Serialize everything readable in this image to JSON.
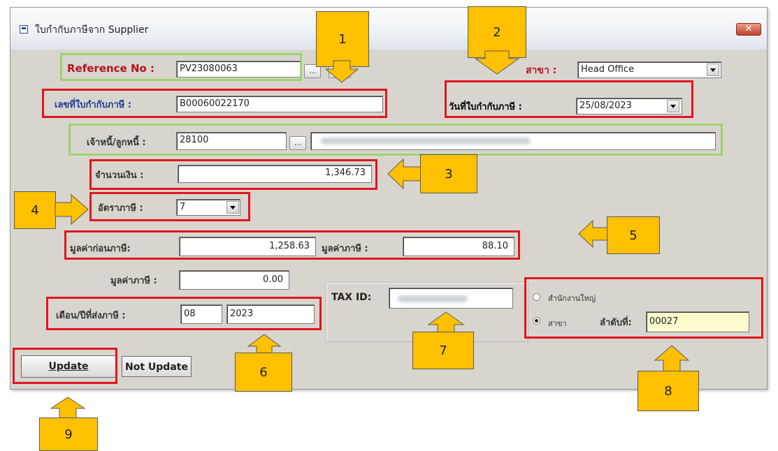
{
  "window": {
    "title": "ใบกำกับภาษีจาก Supplier",
    "close_label": "✕"
  },
  "form": {
    "reference_no": {
      "label": "Reference No :",
      "value": "PV23080063",
      "lookup_btn": "...",
      "extra_btn": ""
    },
    "branch": {
      "label": "สาขา :",
      "value": "Head Office"
    },
    "tax_invoice_no": {
      "label": "เลขที่ใบกำกับภาษี :",
      "value": "B00060022170"
    },
    "tax_invoice_date": {
      "label": "วันที่ใบกำกับภาษี :",
      "value": "25/08/2023"
    },
    "creditor": {
      "label": "เจ้าหนี้/ลูกหนี้ :",
      "code": "28100",
      "lookup_btn": "..."
    },
    "amount": {
      "label": "จำนวนเงิน :",
      "value": "1,346.73"
    },
    "tax_rate": {
      "label": "อัตราภาษี :",
      "value": "7"
    },
    "pre_tax_value": {
      "label": "มูลค่าก่อนภาษี:",
      "value": "1,258.63"
    },
    "tax_value": {
      "label": "มูลค่าภาษี :",
      "value": "88.10"
    },
    "tax_value_2": {
      "label": "มูลค่าภาษี :",
      "value": "0.00"
    },
    "tax_period": {
      "label": "เดือน/ปีที่ส่งภาษี :",
      "month": "08",
      "year": "2023"
    },
    "tax_id": {
      "label": "TAX ID:"
    },
    "office": {
      "head_office_label": "สำนักงานใหญ่",
      "branch_label": "สาขา",
      "seq_label": "ลำดับที่:",
      "seq_value": "00027",
      "selected": "branch"
    }
  },
  "buttons": {
    "update": "Update",
    "not_update": "Not Update"
  },
  "callouts": [
    "1",
    "2",
    "3",
    "4",
    "5",
    "6",
    "7",
    "8",
    "9"
  ],
  "colors": {
    "callout_fill": "#ffc000",
    "highlight_red": "#e0161e",
    "highlight_green": "#9fd26c",
    "label_blue": "#1e3c96",
    "label_red": "#b4141e"
  }
}
